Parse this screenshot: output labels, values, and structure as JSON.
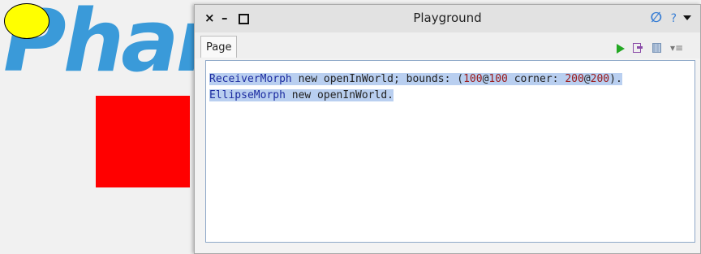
{
  "world": {
    "logo_text": "Phar",
    "colors": {
      "logo": "#3a9ad9",
      "ellipse": "#ffff00",
      "rectangle": "#ff0000"
    }
  },
  "window": {
    "title": "Playground",
    "controls": {
      "close": "×",
      "minimize": "–"
    },
    "tab_label": "Page",
    "toolbar_icons": [
      "sync-icon",
      "help-icon",
      "window-menu-icon",
      "run-icon",
      "export-icon",
      "inspect-icon",
      "more-icon"
    ]
  },
  "code": {
    "line1": {
      "class_name": "ReceiverMorph",
      "part1": " new openInWorld; bounds: (",
      "num1": "100",
      "at1": "@",
      "num2": "100",
      "part2": " corner: ",
      "num3": "200",
      "at2": "@",
      "num4": "200",
      "part3": ")."
    },
    "line2": {
      "class_name": "EllipseMorph",
      "part1": " new openInWorld."
    }
  }
}
